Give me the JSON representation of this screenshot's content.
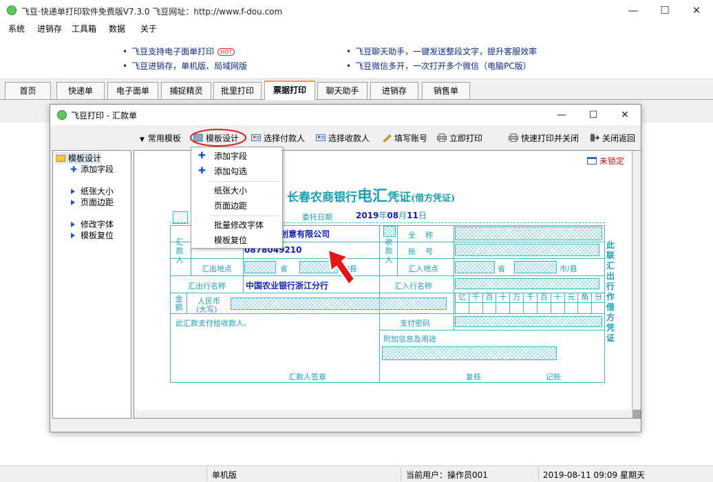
{
  "app": {
    "title": "飞豆·快递单打印软件免费版V7.3.0  飞豆网址：http://www.f-dou.com",
    "min_icon": "—",
    "max_icon": "☐",
    "close_icon": "✕"
  },
  "menu": [
    "系统",
    "进销存",
    "工具箱",
    "数据",
    "关于"
  ],
  "notices": {
    "left": [
      "飞豆支持电子面单打印",
      "飞豆进销存，单机版、局域网版"
    ],
    "hot": "HOT",
    "right": [
      "飞豆聊天助手，一键发送整段文字，提升客服效率",
      "飞豆微信多开，一次打开多个微信（电脑PC版）"
    ]
  },
  "tabs": [
    "首页",
    "快递单",
    "电子面单",
    "捕捉精灵",
    "批里打印",
    "票据打印",
    "聊天助手",
    "进销存",
    "销售单"
  ],
  "active_tab": "票据打印",
  "dialog": {
    "title": "飞豆打印 - 汇款单",
    "toolbar": {
      "templates": "常用模板",
      "design": "模板设计",
      "payer": "选择付款人",
      "payee": "选择收款人",
      "account": "填写账号",
      "print": "立即打印",
      "quick_print": "快速打印并关闭",
      "close": "关闭返回"
    },
    "tree": {
      "root": "模板设计",
      "items": [
        "添加字段",
        "纸张大小",
        "页面边距",
        "修改字体",
        "模板复位"
      ]
    },
    "context_menu": [
      "添加字段",
      "添加勾选",
      "纸张大小",
      "页面边距",
      "批量修改字体",
      "模板复位"
    ],
    "lock_label": "未锁定"
  },
  "voucher": {
    "bank": "长春农商银行",
    "dianhui": "电汇",
    "pingzheng": "凭证",
    "jiefang": "(借方凭证)",
    "date_label": "委托日期",
    "year": "2019",
    "year_unit": "年",
    "month": "08",
    "month_unit": "月",
    "day": "11",
    "day_unit": "日",
    "stamp_label": "☑",
    "payer_label": "汇款人",
    "payer_name": "州市YYY创意有限公司",
    "payer_account": "0878049210",
    "origin_label": "汇出地点",
    "province": "省",
    "city": "市/县",
    "out_bank_label": "汇出行名称",
    "out_bank": "中国农业银行浙江分行",
    "payee_label": "收款人",
    "fullname_label": "全    称",
    "account_label": "账    号",
    "dest_label": "汇入地点",
    "in_bank_label": "汇入行名称",
    "amount_label": "金额",
    "rmb_label": "人民币",
    "rmb_daxie": "(大写)",
    "digits": [
      "亿",
      "千",
      "百",
      "十",
      "万",
      "千",
      "百",
      "十",
      "元",
      "角",
      "分"
    ],
    "pay_password": "支付密码",
    "notice_text": "此汇款支付给收款人。",
    "extra_info": "附加信息及用途",
    "signature": "汇款人签章",
    "review": "复核",
    "record": "记账",
    "side_note": "此联汇出行作借方凭证"
  },
  "status": {
    "mode": "单机版",
    "user": "当前用户：操作员001",
    "datetime": "2019-08-11 09:09 星期天"
  }
}
